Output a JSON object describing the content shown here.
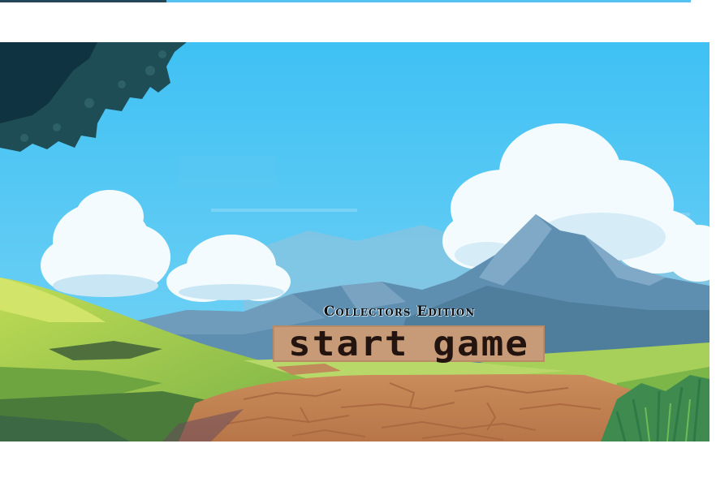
{
  "menu": {
    "edition_label": "Collectors Edition",
    "start_label": "start game"
  },
  "colors": {
    "sky_top": "#3fc1f4",
    "sky_bottom": "#6fd0f5",
    "cloud": "#f4fbff",
    "mountain": "#5f8fb0",
    "grass": "#9fcf55",
    "path": "#cd8d5a",
    "button_bg": "#c89b78",
    "button_text": "#231410"
  }
}
